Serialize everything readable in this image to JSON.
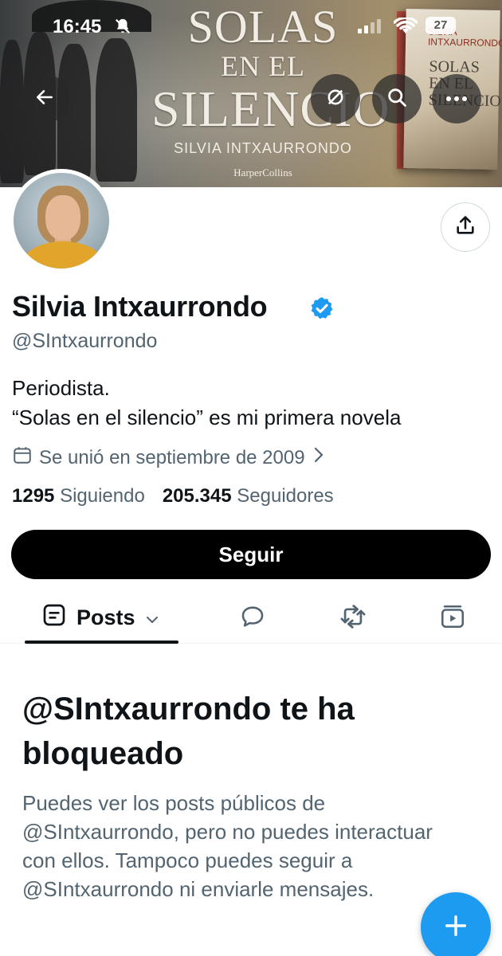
{
  "status_bar": {
    "time": "16:45",
    "battery": "27"
  },
  "banner": {
    "title_line1": "SOLAS",
    "title_line2": "EN EL",
    "title_line3": "SILENCIO",
    "author": "SILVIA INTXAURRONDO",
    "publisher": "HarperCollins",
    "book_author": "SILVIA INTXAURRONDO",
    "book_title": "SOLAS EN EL SILENCIO"
  },
  "profile": {
    "name": "Silvia Intxaurrondo",
    "handle": "@SIntxaurrondo",
    "bio_line1": "Periodista.",
    "bio_line2": "“Solas en el silencio” es mi primera novela",
    "joined": "Se unió en septiembre de 2009",
    "following_count": "1295",
    "following_label": "Siguiendo",
    "followers_count": "205.345",
    "followers_label": "Seguidores",
    "verified": true
  },
  "actions": {
    "follow_label": "Seguir"
  },
  "tabs": {
    "posts_label": "Posts"
  },
  "blocked": {
    "title": "@SIntxaurrondo te ha bloqueado",
    "message": "Puedes ver los posts públicos de @SIntxaurrondo, pero no puedes interactuar con ellos. Tampoco puedes seguir a @SIntxaurrondo ni enviarle mensajes."
  },
  "colors": {
    "accent": "#1d9bf0",
    "verified": "#1d9bf0",
    "secondary_text": "#536471"
  }
}
